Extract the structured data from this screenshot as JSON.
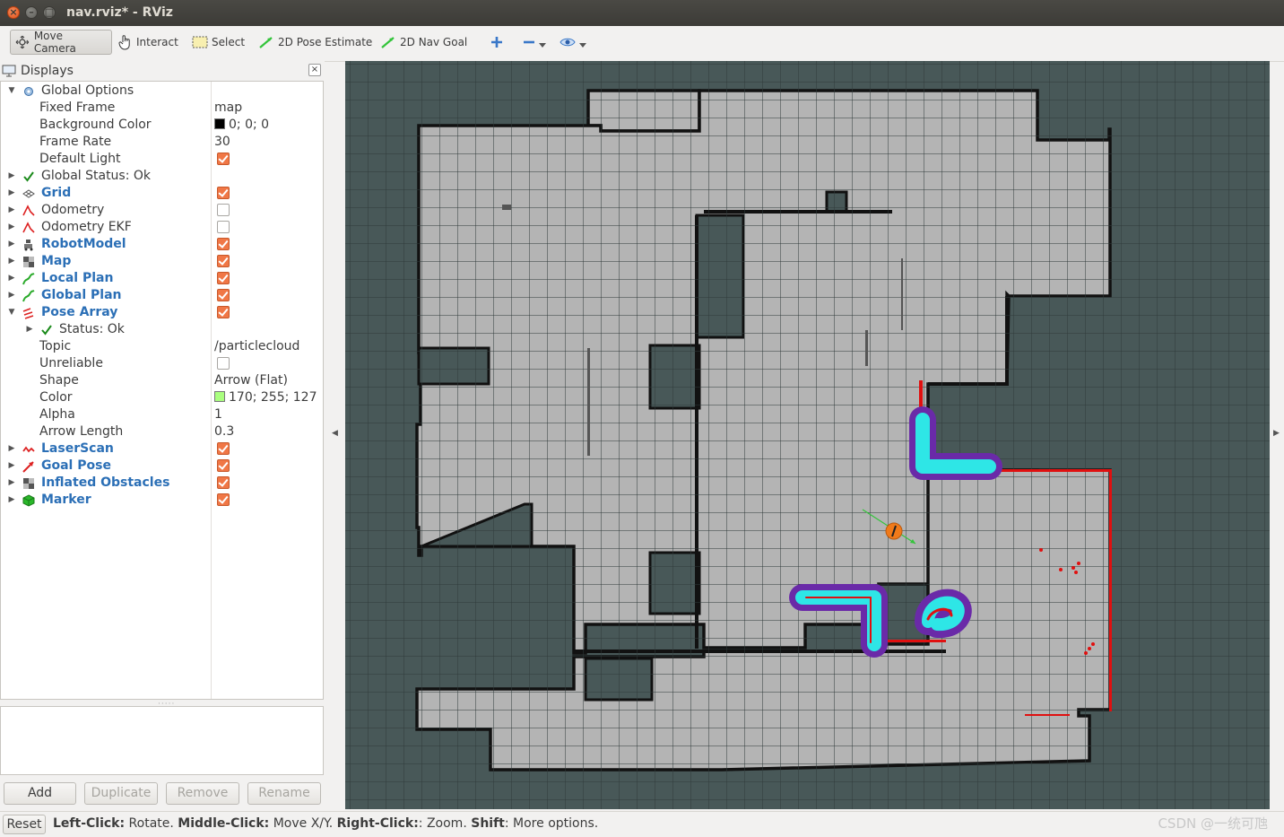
{
  "window": {
    "title": "nav.rviz* - RViz"
  },
  "toolbar": {
    "move_camera": "Move Camera",
    "interact": "Interact",
    "select": "Select",
    "pose_estimate": "2D Pose Estimate",
    "nav_goal": "2D Nav Goal"
  },
  "displays": {
    "title": "Displays",
    "global_options": "Global Options",
    "fixed_frame": {
      "label": "Fixed Frame",
      "value": "map"
    },
    "background_color": {
      "label": "Background Color",
      "value": "0; 0; 0",
      "color": "#000000"
    },
    "frame_rate": {
      "label": "Frame Rate",
      "value": "30"
    },
    "default_light": {
      "label": "Default Light",
      "checked": true
    },
    "global_status": "Global Status: Ok",
    "items": [
      {
        "label": "Grid",
        "checked": true
      },
      {
        "label": "Odometry",
        "checked": false
      },
      {
        "label": "Odometry EKF",
        "checked": false
      },
      {
        "label": "RobotModel",
        "checked": true
      },
      {
        "label": "Map",
        "checked": true
      },
      {
        "label": "Local Plan",
        "checked": true
      },
      {
        "label": "Global Plan",
        "checked": true
      },
      {
        "label": "Pose Array",
        "checked": true
      }
    ],
    "pose_array": {
      "status": "Status: Ok",
      "topic": {
        "label": "Topic",
        "value": "/particlecloud"
      },
      "unreliable": {
        "label": "Unreliable",
        "checked": false
      },
      "shape": {
        "label": "Shape",
        "value": "Arrow (Flat)"
      },
      "color": {
        "label": "Color",
        "value": "170; 255; 127",
        "color": "#aaff7f"
      },
      "alpha": {
        "label": "Alpha",
        "value": "1"
      },
      "arrow_length": {
        "label": "Arrow Length",
        "value": "0.3"
      }
    },
    "more_items": [
      {
        "label": "LaserScan",
        "checked": true
      },
      {
        "label": "Goal Pose",
        "checked": true
      },
      {
        "label": "Inflated Obstacles",
        "checked": true
      },
      {
        "label": "Marker",
        "checked": true
      }
    ],
    "buttons": {
      "add": "Add",
      "duplicate": "Duplicate",
      "remove": "Remove",
      "rename": "Rename"
    }
  },
  "statusbar": {
    "reset": "Reset",
    "left_click": "Left-Click:",
    "left_click_desc": "Rotate.",
    "middle_click": "Middle-Click:",
    "middle_click_desc": "Move X/Y.",
    "right_click": "Right-Click:",
    "right_click_desc": ": Zoom.",
    "shift": "Shift",
    "shift_desc": ": More options.",
    "watermark": "CSDN @一统可虺"
  },
  "colors": {
    "viewport_bg": "#485858",
    "map_free": "#b4b4b4",
    "inflation_cyan": "#2ee6e6",
    "inflation_purple": "#6a2aa8",
    "laser": "#e01010",
    "robot": "#f07a1a"
  }
}
